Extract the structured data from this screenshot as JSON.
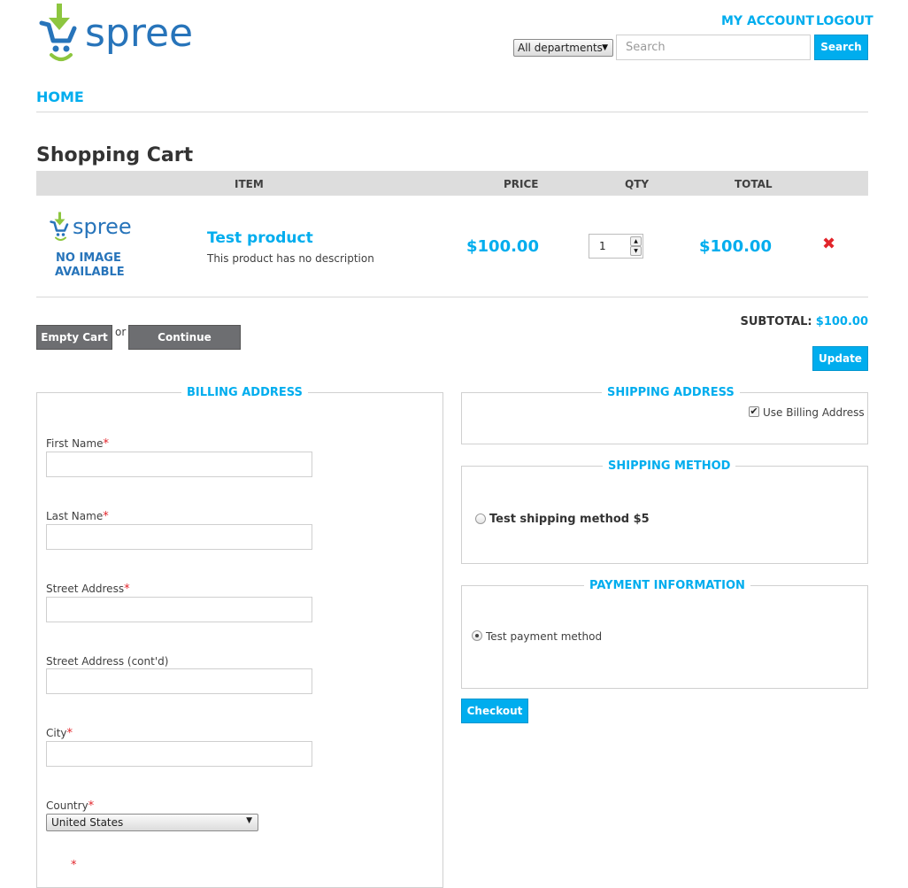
{
  "header": {
    "logo_text": "spree",
    "my_account": "MY ACCOUNT",
    "logout": "LOGOUT",
    "department_select": "All departments",
    "search_placeholder": "Search",
    "search_button": "Search"
  },
  "nav": {
    "home": "HOME"
  },
  "cart": {
    "title": "Shopping Cart",
    "columns": {
      "item": "ITEM",
      "price": "PRICE",
      "qty": "QTY",
      "total": "TOTAL"
    },
    "line_item": {
      "image_logo_text": "spree",
      "no_image_line1": "NO IMAGE",
      "no_image_line2": "AVAILABLE",
      "name": "Test product",
      "description": "This product has no description",
      "price": "$100.00",
      "quantity": "1",
      "total": "$100.00"
    },
    "empty_cart": "Empty Cart",
    "or_text": "or",
    "continue_shopping": "Continue shopping",
    "subtotal_label": "SUBTOTAL:",
    "subtotal_value": "$100.00",
    "update": "Update"
  },
  "billing": {
    "legend": "BILLING ADDRESS",
    "first_name": "First Name",
    "last_name": "Last Name",
    "street": "Street Address",
    "street2": "Street Address (cont'd)",
    "city": "City",
    "country": "Country",
    "country_value": "United States",
    "required_mark": "*"
  },
  "shipping": {
    "legend": "SHIPPING ADDRESS",
    "use_billing": "Use Billing Address",
    "use_billing_checked": true
  },
  "shipping_method": {
    "legend": "SHIPPING METHOD",
    "option": "Test shipping method $5"
  },
  "payment": {
    "legend": "PAYMENT INFORMATION",
    "option": "Test payment method"
  },
  "checkout": "Checkout",
  "colors": {
    "accent": "#00adee",
    "logo_blue": "#2774ba",
    "logo_green": "#8dc63f",
    "button_gray": "#6d6e71",
    "remove_red": "#e2252b"
  }
}
